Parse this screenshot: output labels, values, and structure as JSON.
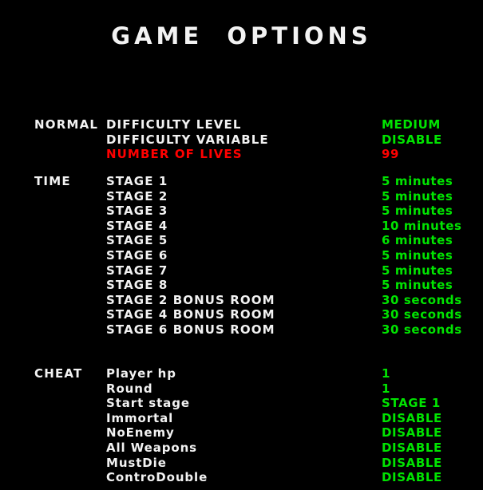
{
  "screen": {
    "title": "GAME  OPTIONS",
    "background_color": "#000000",
    "label_color": "#f2f2f2",
    "value_color": "#00e400",
    "highlight_color": "#ff0000"
  },
  "sections": [
    {
      "label": "NORMAL",
      "rows": [
        {
          "label": "DIFFICULTY LEVEL",
          "value": "MEDIUM",
          "selected": false
        },
        {
          "label": "DIFFICULTY VARIABLE",
          "value": "DISABLE",
          "selected": false
        },
        {
          "label": "NUMBER OF LIVES",
          "value": "99",
          "selected": true
        }
      ]
    },
    {
      "label": "TIME",
      "rows": [
        {
          "label": "STAGE 1",
          "value": "5 minutes",
          "selected": false
        },
        {
          "label": "STAGE 2",
          "value": "5 minutes",
          "selected": false
        },
        {
          "label": "STAGE 3",
          "value": "5 minutes",
          "selected": false
        },
        {
          "label": "STAGE 4",
          "value": "10 minutes",
          "selected": false
        },
        {
          "label": "STAGE 5",
          "value": "6 minutes",
          "selected": false
        },
        {
          "label": "STAGE 6",
          "value": "5 minutes",
          "selected": false
        },
        {
          "label": "STAGE 7",
          "value": "5 minutes",
          "selected": false
        },
        {
          "label": "STAGE 8",
          "value": "5 minutes",
          "selected": false
        },
        {
          "label": "STAGE 2 BONUS ROOM",
          "value": "30 seconds",
          "selected": false
        },
        {
          "label": "STAGE 4 BONUS ROOM",
          "value": "30 seconds",
          "selected": false
        },
        {
          "label": "STAGE 6 BONUS ROOM",
          "value": "30 seconds",
          "selected": false
        }
      ]
    },
    {
      "label": "CHEAT",
      "rows": [
        {
          "label": "Player hp",
          "value": "1",
          "selected": false
        },
        {
          "label": "Round",
          "value": "1",
          "selected": false
        },
        {
          "label": "Start stage",
          "value": "STAGE 1",
          "selected": false
        },
        {
          "label": "Immortal",
          "value": "DISABLE",
          "selected": false
        },
        {
          "label": "NoEnemy",
          "value": "DISABLE",
          "selected": false
        },
        {
          "label": "All Weapons",
          "value": "DISABLE",
          "selected": false
        },
        {
          "label": "MustDie",
          "value": "DISABLE",
          "selected": false
        },
        {
          "label": "ControDouble",
          "value": "DISABLE",
          "selected": false
        }
      ]
    }
  ]
}
